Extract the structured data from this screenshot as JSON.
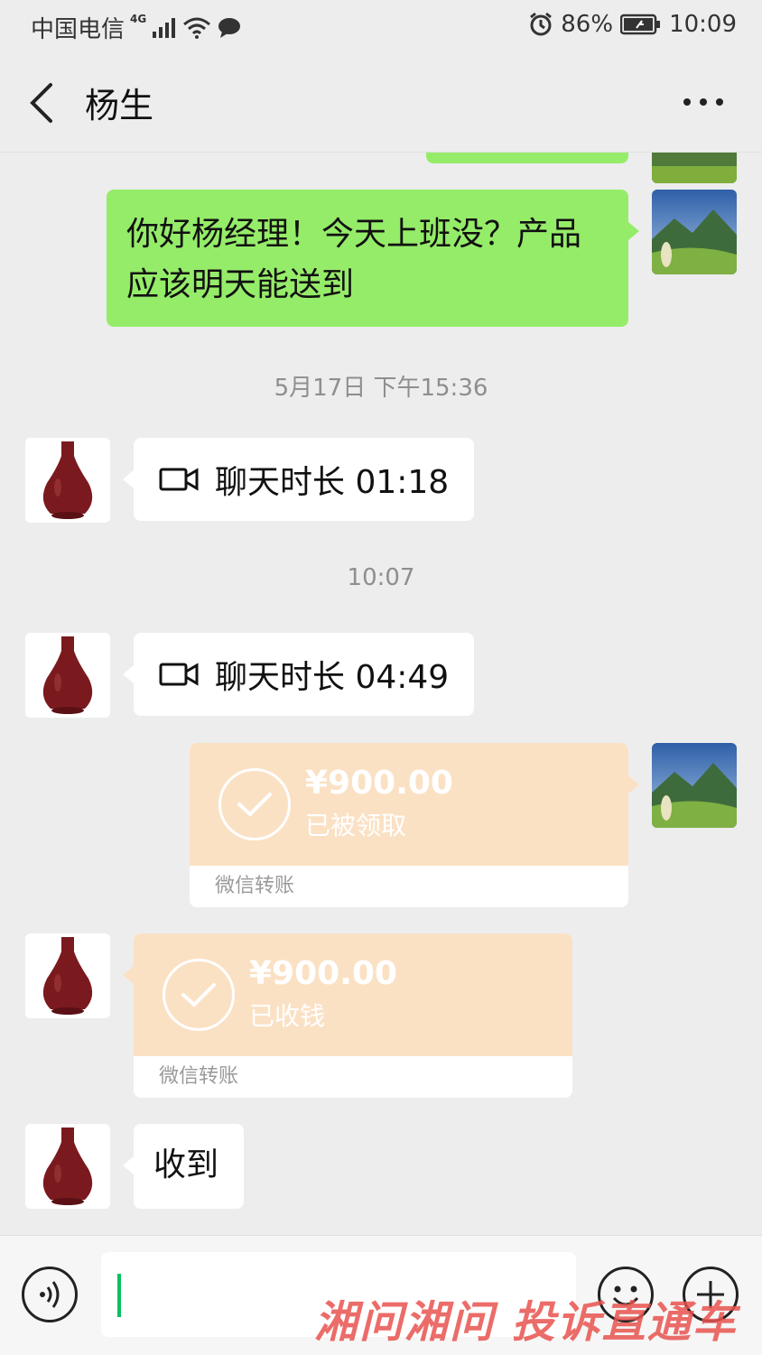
{
  "status_bar": {
    "carrier": "中国电信",
    "network": "4G",
    "battery": "86%",
    "time": "10:09"
  },
  "header": {
    "title": "杨生",
    "back_icon": "chevron-left-icon",
    "more_icon": "more-dots-icon"
  },
  "messages": {
    "m1": {
      "text": "你好杨经理！今天上班没？产品应该明天能送到"
    },
    "ts1": "5月17日 下午15:36",
    "call1": {
      "label": "聊天时长 01:18"
    },
    "ts2": "10:07",
    "call2": {
      "label": "聊天时长 04:49"
    },
    "transfer_out": {
      "amount": "¥900.00",
      "status": "已被领取",
      "footer": "微信转账"
    },
    "transfer_in": {
      "amount": "¥900.00",
      "status": "已收钱",
      "footer": "微信转账"
    },
    "reply": {
      "text": "收到"
    }
  },
  "input_bar": {
    "input_value": "",
    "voice_icon": "voice-icon",
    "emoji_icon": "emoji-icon",
    "plus_icon": "plus-icon"
  },
  "watermark": "湘问湘问 投诉直通车",
  "colors": {
    "background": "#ededed",
    "self_bubble": "#95ec69",
    "other_bubble": "#ffffff",
    "transfer": "#fbe1c4",
    "caret": "#07c160"
  }
}
